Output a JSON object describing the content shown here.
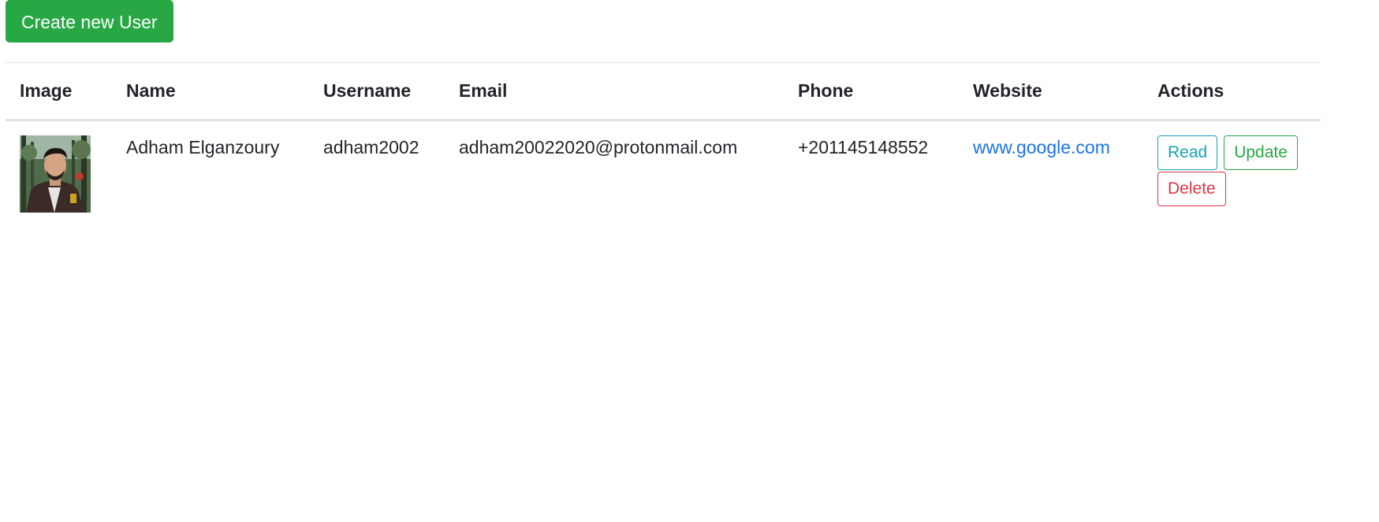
{
  "toolbar": {
    "create_label": "Create new User"
  },
  "table": {
    "headers": [
      "Image",
      "Name",
      "Username",
      "Email",
      "Phone",
      "Website",
      "Actions"
    ],
    "rows": [
      {
        "name": "Adham Elganzoury",
        "username": "adham2002",
        "email": "adham20022020@protonmail.com",
        "phone": "+201145148552",
        "website": "www.google.com",
        "actions": {
          "read": "Read",
          "update": "Update",
          "delete": "Delete"
        }
      }
    ]
  },
  "colors": {
    "primary_green": "#28a745",
    "info": "#17a2b8",
    "danger": "#dc3545",
    "link": "#1a73e8"
  }
}
